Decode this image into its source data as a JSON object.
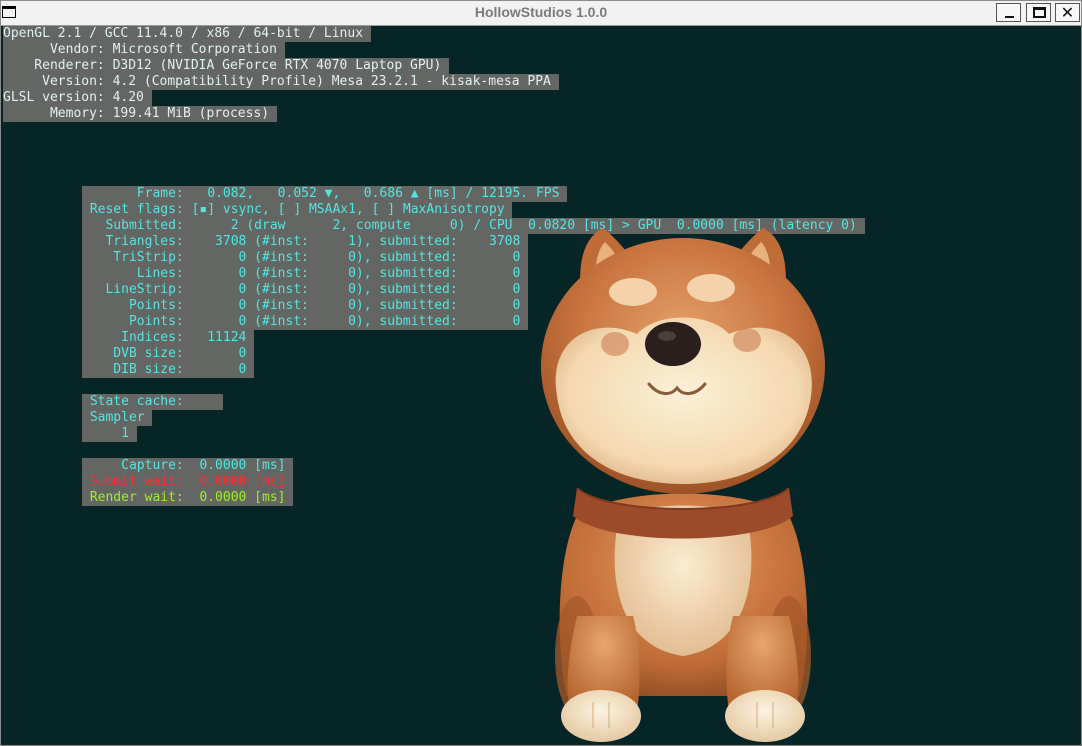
{
  "window": {
    "title": "HollowStudios 1.0.0",
    "buttons": {
      "minimize": "minimize",
      "maximize": "maximize",
      "close": "✕"
    }
  },
  "header_lines": [
    "OpenGL 2.1 / GCC 11.4.0 / x86 / 64-bit / Linux ",
    "      Vendor: Microsoft Corporation ",
    "    Renderer: D3D12 (NVIDIA GeForce RTX 4070 Laptop GPU) ",
    "     Version: 4.2 (Compatibility Profile) Mesa 23.2.1 - kisak-mesa PPA ",
    "GLSL version: 4.20 ",
    "      Memory: 199.41 MiB (process) "
  ],
  "stats_lines": [
    "       Frame:   0.082,   0.052 ▼,   0.686 ▲ [ms] / 12195. FPS ",
    " Reset flags: [▪] vsync, [ ] MSAAx1, [ ] MaxAnisotropy ",
    "   Submitted:      2 (draw      2, compute     0) / CPU  0.0820 [ms] > GPU  0.0000 [ms] (latency 0) ",
    "   Triangles:    3708 (#inst:     1), submitted:    3708 ",
    "    TriStrip:       0 (#inst:     0), submitted:       0 ",
    "       Lines:       0 (#inst:     0), submitted:       0 ",
    "   LineStrip:       0 (#inst:     0), submitted:       0 ",
    "      Points:       0 (#inst:     0), submitted:       0 ",
    "      Points:       0 (#inst:     0), submitted:       0 ",
    "     Indices:   11124 ",
    "    DVB size:       0 ",
    "    DIB size:       0 "
  ],
  "state_lines": [
    " State cache:     ",
    " Sampler ",
    "     1 "
  ],
  "timing_lines": {
    "capture": "     Capture:  0.0000 [ms] ",
    "submit": " Submit wait:  0.0000 [ms] ",
    "render": " Render wait:  0.0000 [ms] "
  },
  "colors": {
    "background": "#052526",
    "panel": "#646664",
    "cyan_text": "#4fe6e4",
    "header_text": "#dff1f1",
    "submit_wait": "#ff2d2d",
    "render_wait": "#9af028"
  },
  "scene": {
    "model": "shiba-inu-dog"
  }
}
